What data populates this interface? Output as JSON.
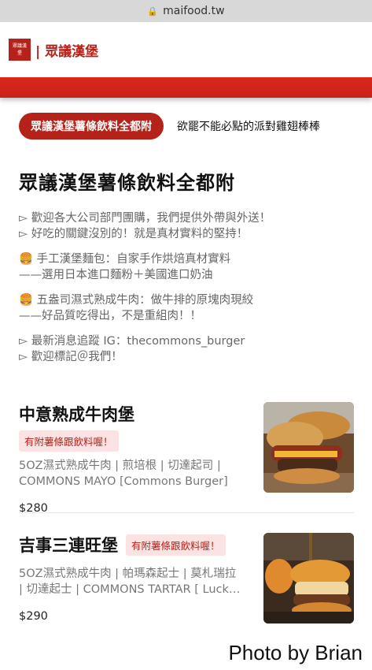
{
  "browser": {
    "url": "maifood.tw"
  },
  "header": {
    "logo_text": "眾議漢堡",
    "brand": "| 眾議漢堡"
  },
  "tabs": {
    "active": "眾議漢堡薯條飲料全都附",
    "next": "欲罷不能必點的派對雞翅棒棒"
  },
  "section": {
    "title": "眾議漢堡薯條飲料全都附",
    "lines": [
      "▻ 歡迎各大公司部門團購，我們提供外帶與外送！",
      "▻ 好吃的關鍵沒別的！就是真材實料的堅持！",
      "",
      "🍔 手工漢堡麵包：自家手作烘焙真材實料",
      "——選用日本進口麵粉＋美國進口奶油",
      "",
      "🍔 五盎司濕式熟成牛肉：做牛排的原塊肉現絞",
      "——好品質吃得出，不是重組肉！！",
      "",
      "▻ 最新消息追蹤 IG：thecommons_burger",
      "▻ 歡迎標記＠我們！"
    ]
  },
  "menu": [
    {
      "name": "中意熟成牛肉堡",
      "badge": "有附薯條跟飲料喔！",
      "desc1": "5OZ濕式熟成牛肉 | 煎培根 | 切達起司 |",
      "desc2": "COMMONS MAYO [Commons Burger]",
      "price": "$280"
    },
    {
      "name": "吉事三連旺堡",
      "badge": "有附薯條跟飲料喔！",
      "desc1": "5OZ濕式熟成牛肉 | 帕瑪森起士 | 莫札瑞拉",
      "desc2": "| 切達起士 | COMMONS TARTAR [ Luck…",
      "price": "$290"
    }
  ],
  "watermark": "Photo by Brian",
  "colors": {
    "brand_red": "#b5221a",
    "bar_red": "#d9281b",
    "badge_bg": "#fbe3e3"
  }
}
